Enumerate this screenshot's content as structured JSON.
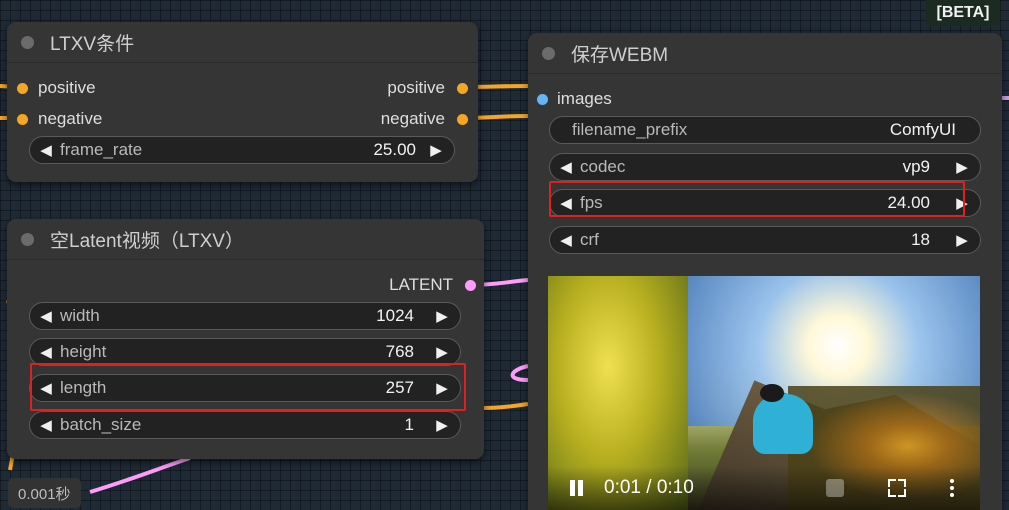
{
  "beta_badge": "[BETA]",
  "exec_time": "0.001秒",
  "colors": {
    "conditioning": "#f5a623",
    "latent": "#ff9cf9",
    "image": "#64b5f6",
    "highlight": "#e02020"
  },
  "node_ltxv_conditioning": {
    "title": "LTXV条件",
    "inputs": [
      "positive",
      "negative"
    ],
    "outputs": [
      "positive",
      "negative"
    ],
    "widgets": [
      {
        "name": "frame_rate",
        "value": "25.00"
      }
    ]
  },
  "node_empty_latent": {
    "title": "空Latent视频（LTXV）",
    "output": "LATENT",
    "widgets": [
      {
        "name": "width",
        "value": "1024"
      },
      {
        "name": "height",
        "value": "768"
      },
      {
        "name": "length",
        "value": "257"
      },
      {
        "name": "batch_size",
        "value": "1"
      }
    ]
  },
  "node_save_webm": {
    "title": "保存WEBM",
    "input": "images",
    "widgets": [
      {
        "name": "filename_prefix",
        "value": "ComfyUI"
      },
      {
        "name": "codec",
        "value": "vp9"
      },
      {
        "name": "fps",
        "value": "24.00"
      },
      {
        "name": "crf",
        "value": "18"
      }
    ],
    "video": {
      "time_display": "0:01 / 0:10",
      "state": "playing"
    }
  },
  "icons": {
    "decrement": "◀",
    "increment": "▶",
    "pause": "pause-icon",
    "volume": "volume-icon",
    "fullscreen": "fullscreen-icon",
    "more": "more-options-icon"
  }
}
